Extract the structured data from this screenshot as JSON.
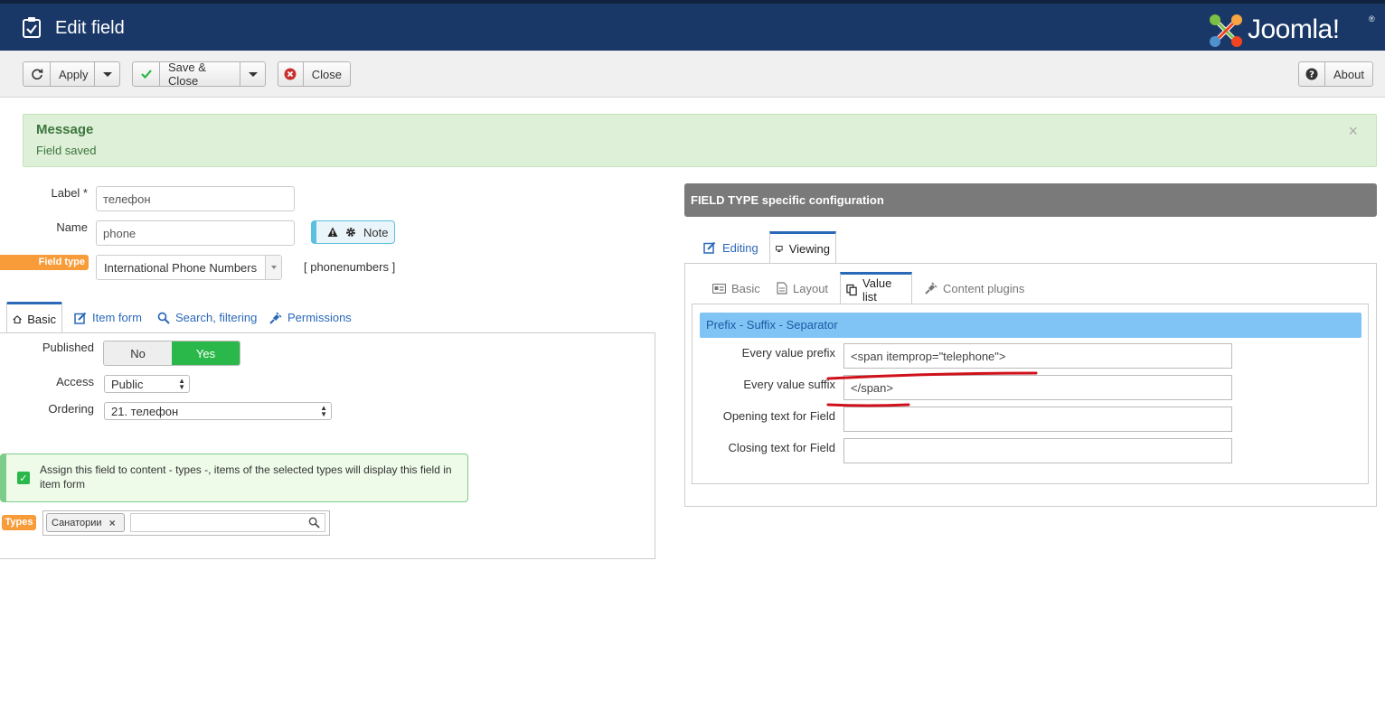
{
  "header": {
    "title": "Edit field",
    "logo_text": "Joomla!",
    "logo_reg": "®"
  },
  "toolbar": {
    "apply_label": "Apply",
    "save_close_label": "Save & Close",
    "close_label": "Close",
    "about_label": "About"
  },
  "message": {
    "title": "Message",
    "text": "Field saved",
    "close": "×"
  },
  "form": {
    "label_label": "Label *",
    "label_value": "телефон",
    "name_label": "Name",
    "name_value": "phone",
    "note_label": "Note",
    "field_type_label": "Field type",
    "field_type_value": "International Phone Numbers",
    "field_type_code": "[ phonenumbers ]"
  },
  "left_tabs": [
    "Basic",
    "Item form",
    "Search, filtering",
    "Permissions"
  ],
  "basic": {
    "published_label": "Published",
    "published_no": "No",
    "published_yes": "Yes",
    "access_label": "Access",
    "access_value": "Public",
    "ordering_label": "Ordering",
    "ordering_value": "21. телефон",
    "assign_text": "Assign this field to content - types -, items of the selected types will display this field in item form",
    "types_label": "Types",
    "types_tag": "Санатории"
  },
  "right": {
    "header": "FIELD TYPE specific configuration",
    "tabs": [
      "Editing",
      "Viewing"
    ],
    "subtabs": [
      "Basic",
      "Layout",
      "Value list",
      "Content plugins"
    ],
    "section": "Prefix - Suffix - Separator",
    "fields": [
      {
        "label": "Every value prefix",
        "value": "<span itemprop=\"telephone\">"
      },
      {
        "label": "Every value suffix",
        "value": "</span>"
      },
      {
        "label": "Opening text for Field",
        "value": ""
      },
      {
        "label": "Closing text for Field",
        "value": ""
      }
    ]
  },
  "colors": {
    "header_bg": "#1a3867",
    "accent_blue": "#2a69b8",
    "success_green": "#2bb84a",
    "orange_label": "#f89c3a",
    "annotation_red": "#d0111b"
  }
}
